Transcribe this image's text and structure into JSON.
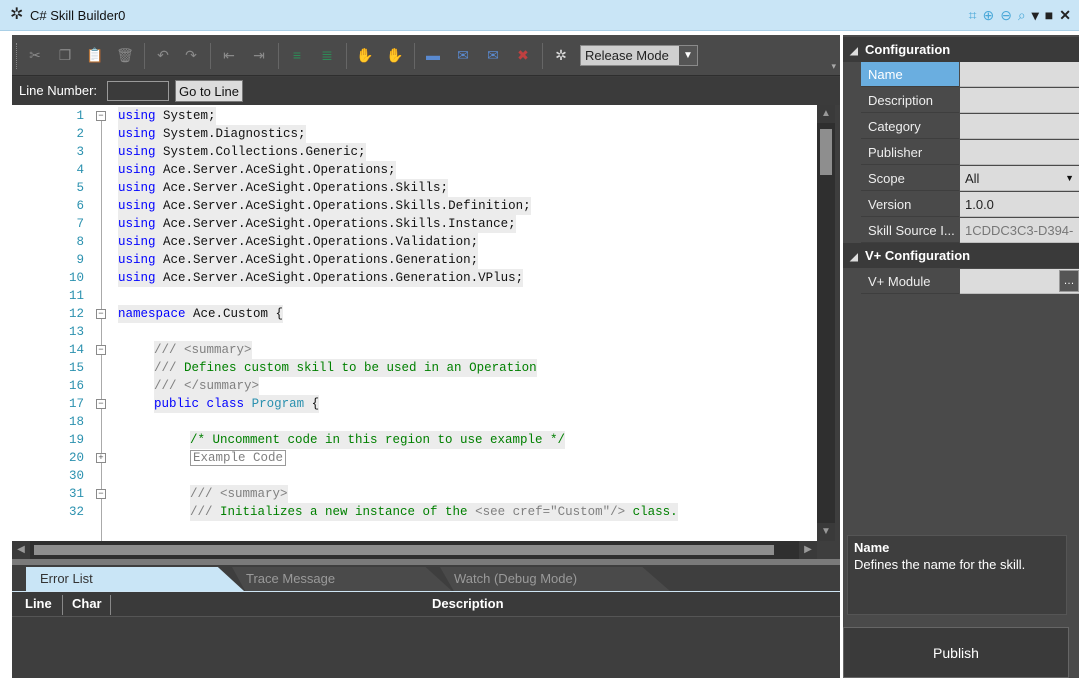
{
  "window": {
    "title": "C# Skill Builder0"
  },
  "toolbar": {
    "mode_value": "Release Mode"
  },
  "linebar": {
    "label": "Line Number:",
    "goto_label": "Go to Line"
  },
  "editor": {
    "lines": [
      {
        "n": "1",
        "text": "using System;"
      },
      {
        "n": "2",
        "text": "using System.Diagnostics;"
      },
      {
        "n": "3",
        "text": "using System.Collections.Generic;"
      },
      {
        "n": "4",
        "text": "using Ace.Server.AceSight.Operations;"
      },
      {
        "n": "5",
        "text": "using Ace.Server.AceSight.Operations.Skills;"
      },
      {
        "n": "6",
        "text": "using Ace.Server.AceSight.Operations.Skills.Definition;"
      },
      {
        "n": "7",
        "text": "using Ace.Server.AceSight.Operations.Skills.Instance;"
      },
      {
        "n": "8",
        "text": "using Ace.Server.AceSight.Operations.Validation;"
      },
      {
        "n": "9",
        "text": "using Ace.Server.AceSight.Operations.Generation;"
      },
      {
        "n": "10",
        "text": "using Ace.Server.AceSight.Operations.Generation.VPlus;"
      },
      {
        "n": "11",
        "text": ""
      },
      {
        "n": "12",
        "text": "namespace Ace.Custom {"
      },
      {
        "n": "13",
        "text": ""
      },
      {
        "n": "14",
        "text": "/// <summary>"
      },
      {
        "n": "15",
        "text": "/// Defines custom skill to be used in an Operation"
      },
      {
        "n": "16",
        "text": "/// </summary>"
      },
      {
        "n": "17",
        "text": "public class Program {"
      },
      {
        "n": "18",
        "text": ""
      },
      {
        "n": "19",
        "text": "/* Uncomment code in this region to use example */"
      },
      {
        "n": "20",
        "text": "Example Code"
      },
      {
        "n": "30",
        "text": ""
      },
      {
        "n": "31",
        "text": "/// <summary>"
      },
      {
        "n": "32",
        "text": "/// Initializes a new instance of the <see cref=\"Custom\"/> class."
      }
    ]
  },
  "bottom": {
    "tabs": [
      "Error List",
      "Trace Message",
      "Watch (Debug Mode)"
    ],
    "columns": {
      "line": "Line",
      "char": "Char",
      "description": "Description"
    }
  },
  "properties": {
    "config_header": "Configuration",
    "name_label": "Name",
    "name_value": "",
    "description_label": "Description",
    "description_value": "",
    "category_label": "Category",
    "category_value": "",
    "publisher_label": "Publisher",
    "publisher_value": "",
    "scope_label": "Scope",
    "scope_value": "All",
    "version_label": "Version",
    "version_value": "1.0.0",
    "source_label": "Skill Source I...",
    "source_value": "1CDDC3C3-D394-",
    "vplus_header": "V+ Configuration",
    "module_label": "V+ Module",
    "module_value": ""
  },
  "description_panel": {
    "title": "Name",
    "text": "Defines the name for the skill."
  },
  "publish": {
    "label": "Publish"
  },
  "colors": {
    "accent": "#6aaee0",
    "titlebar": "#c9e5f6",
    "panel": "#3e3e3e"
  }
}
